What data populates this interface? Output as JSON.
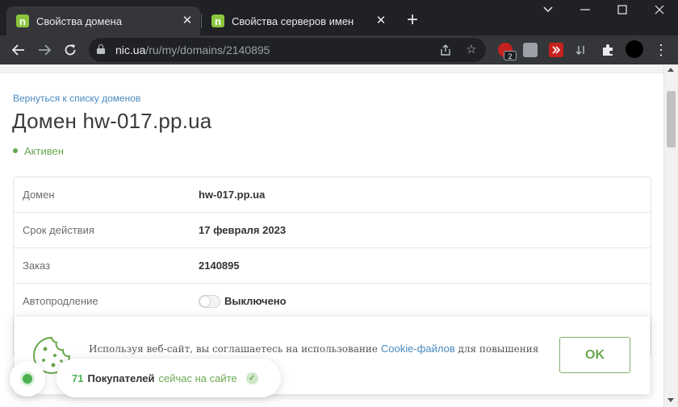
{
  "browser": {
    "tabs": [
      {
        "title": "Свойства домена",
        "favicon": "n",
        "active": true
      },
      {
        "title": "Свойства серверов имен",
        "favicon": "n",
        "active": false
      }
    ],
    "new_tab_label": "+",
    "url_host": "nic.ua",
    "url_path": "/ru/my/domains/2140895",
    "extension_badge": "2"
  },
  "page": {
    "back_link": "Вернуться к списку доменов",
    "title": "Домен hw-017.pp.ua",
    "status": "Активен",
    "info_rows": [
      {
        "label": "Домен",
        "value": "hw-017.pp.ua"
      },
      {
        "label": "Срок действия",
        "value": "17 февраля 2023"
      },
      {
        "label": "Заказ",
        "value": "2140895"
      },
      {
        "label": "Автопродление",
        "value": "Выключено",
        "toggle_on": false
      }
    ]
  },
  "cookie_banner": {
    "text_before": "Используя веб-сайт, вы соглашаетесь на использование ",
    "link_text": "Cookie-файлов",
    "text_after": " для повышения",
    "ok_label": "OK"
  },
  "buyers_widget": {
    "count": "71",
    "label": "Покупателей",
    "suffix": "сейчас на сайте"
  },
  "colors": {
    "accent_green": "#6aa84f",
    "link_blue": "#4a8abf",
    "favicon_green": "#8cc63f"
  }
}
